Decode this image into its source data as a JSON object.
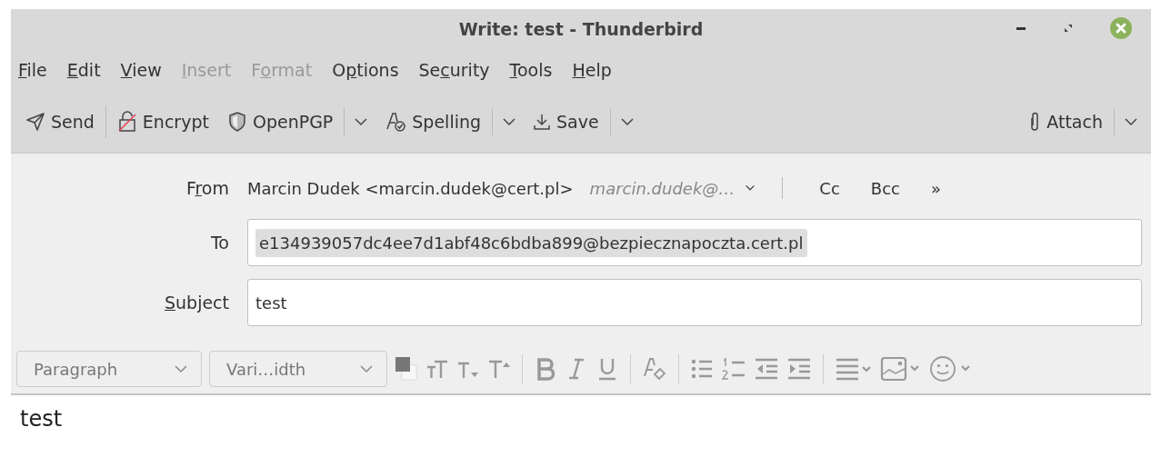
{
  "window": {
    "title": "Write: test - Thunderbird"
  },
  "menu": [
    {
      "key": "F",
      "after": "ile",
      "disabled": false
    },
    {
      "key": "E",
      "after": "dit",
      "disabled": false
    },
    {
      "key": "V",
      "after": "iew",
      "disabled": false
    },
    {
      "key": "I",
      "after": "nsert",
      "disabled": true
    },
    {
      "before": "F",
      "key": "o",
      "after": "rmat",
      "disabled": true
    },
    {
      "before": "O",
      "key": "p",
      "after": "tions",
      "disabled": false
    },
    {
      "before": "Se",
      "key": "c",
      "after": "urity",
      "disabled": false
    },
    {
      "key": "T",
      "after": "ools",
      "disabled": false
    },
    {
      "key": "H",
      "after": "elp",
      "disabled": false
    }
  ],
  "toolbar": [
    {
      "kind": "send",
      "label": "Send",
      "dropdown": false
    },
    {
      "kind": "encrypt",
      "label": "Encrypt",
      "dropdown": false
    },
    {
      "kind": "openpgp",
      "label": "OpenPGP",
      "dropdown": true
    },
    {
      "kind": "spelling",
      "label": "Spelling",
      "dropdown": true
    },
    {
      "kind": "save",
      "label": "Save",
      "dropdown": true
    }
  ],
  "attach": {
    "label": "Attach"
  },
  "from": {
    "label": {
      "before": "F",
      "key": "r",
      "after": "om"
    },
    "value": "Marcin Dudek <marcin.dudek@cert.pl>",
    "identity": "marcin.dudek@…",
    "cc": "Cc",
    "bcc": "Bcc",
    "more": "»"
  },
  "to": {
    "label": "To",
    "recipient": "e134939057dc4ee7d1abf48c6bdba899@bezpiecznapoczta.cert.pl"
  },
  "subject": {
    "label": {
      "key": "S",
      "after": "ubject"
    },
    "value": "test"
  },
  "format": {
    "paragraph": "Paragraph",
    "font": "Vari…idth"
  },
  "body": "test"
}
